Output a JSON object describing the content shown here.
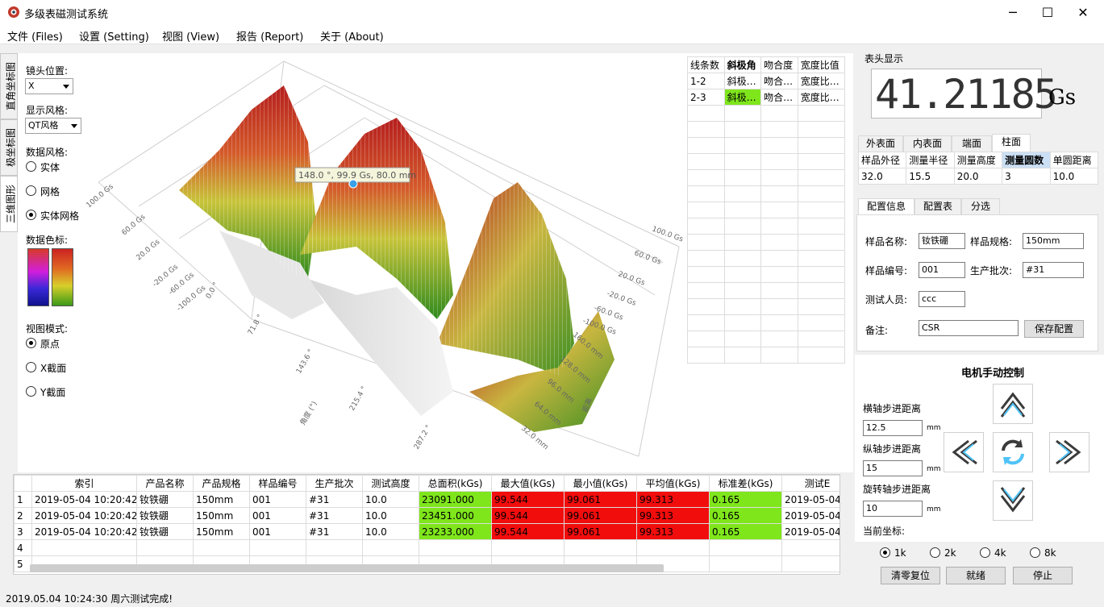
{
  "window": {
    "title": "多级表磁测试系统",
    "minimize": "─",
    "maximize": "☐",
    "close": "✕"
  },
  "menu": [
    "文件 (Files)",
    "设置 (Setting)",
    "视图 (View)",
    "报告 (Report)",
    "关于 (About)"
  ],
  "side_tabs": [
    "直角坐标图",
    "极坐标图",
    "三维图形"
  ],
  "controls": {
    "lens_label": "镜头位置:",
    "lens_value": "X",
    "display_style_label": "显示风格:",
    "display_style_value": "QT风格",
    "data_style_label": "数据风格:",
    "data_style_options": [
      "实体",
      "网格",
      "实体网格"
    ],
    "data_style_selected": 2,
    "color_scale_label": "数据色标:",
    "view_mode_label": "视图模式:",
    "view_mode_options": [
      "原点",
      "X截面",
      "Y截面"
    ],
    "view_mode_selected": 0
  },
  "plot": {
    "tooltip": "148.0 °, 99.9 Gs, 80.0 mm",
    "left_axis_labels": [
      "100.0 Gs",
      "60.0 Gs",
      "20.0 Gs",
      "-20.0 Gs",
      "-60.0 Gs",
      "-100.0 Gs"
    ],
    "right_axis_labels": [
      "100.0 Gs",
      "60.0 Gs",
      "20.0 Gs",
      "-20.0 Gs",
      "-60.0 Gs",
      "-100.0 Gs"
    ],
    "angle_labels": [
      "0.0 °",
      "71.8 °",
      "143.6 °",
      "215.4 °",
      "287.2 °"
    ],
    "angle_axis_title": "角度 (°)",
    "mm_labels": [
      "160.0 mm",
      "128.0 mm",
      "96.0 mm",
      "64.0 mm",
      "32.0 mm"
    ],
    "mm_axis_title": "距离"
  },
  "lines_table": {
    "headers": [
      "线条数",
      "斜极角",
      "吻合度",
      "宽度比值"
    ],
    "rows": [
      [
        "1-2",
        "斜极…",
        "吻合…",
        "宽度比…"
      ],
      [
        "2-3",
        "斜极…",
        "吻合…",
        "宽度比…"
      ]
    ]
  },
  "data_table": {
    "headers": [
      "",
      "索引",
      "产品名称",
      "产品规格",
      "样品编号",
      "生产批次",
      "测试高度",
      "总面积(kGs)",
      "最大值(kGs)",
      "最小值(kGs)",
      "平均值(kGs)",
      "标准差(kGs)",
      "测试E"
    ],
    "rows": [
      [
        "1",
        "2019-05-04 10:20:42",
        "钕铁硼",
        "150mm",
        "001",
        "#31",
        "10.0",
        "23091.000",
        "99.544",
        "99.061",
        "99.313",
        "0.165",
        "2019-05-04"
      ],
      [
        "2",
        "2019-05-04 10:20:42",
        "钕铁硼",
        "150mm",
        "001",
        "#31",
        "10.0",
        "23451.000",
        "99.544",
        "99.061",
        "99.313",
        "0.165",
        "2019-05-04"
      ],
      [
        "3",
        "2019-05-04 10:20:42",
        "钕铁硼",
        "150mm",
        "001",
        "#31",
        "10.0",
        "23233.000",
        "99.544",
        "99.061",
        "99.313",
        "0.165",
        "2019-05-04"
      ],
      [
        "4",
        "",
        "",
        "",
        "",
        "",
        "",
        "",
        "",
        "",
        "",
        "",
        ""
      ],
      [
        "5",
        "",
        "",
        "",
        "",
        "",
        "",
        "",
        "",
        "",
        "",
        "",
        ""
      ]
    ]
  },
  "meter": {
    "label": "表头显示",
    "value": "41.21185",
    "unit": "Gs"
  },
  "surface_tabs": [
    "外表面",
    "内表面",
    "端面",
    "柱面"
  ],
  "surface_tab_selected": 3,
  "surface_table": {
    "headers": [
      "样品外径",
      "测量半径",
      "测量高度",
      "测量圆数",
      "单圆距离"
    ],
    "values": [
      "32.0",
      "15.5",
      "20.0",
      "3",
      "10.0"
    ]
  },
  "config_tabs": [
    "配置信息",
    "配置表",
    "分选"
  ],
  "config": {
    "name_label": "样品名称:",
    "name_value": "钕铁硼",
    "spec_label": "样品规格:",
    "spec_value": "150mm",
    "serial_label": "样品编号:",
    "serial_value": "001",
    "batch_label": "生产批次:",
    "batch_value": "#31",
    "tester_label": "测试人员:",
    "tester_value": "ccc",
    "note_label": "备注:",
    "note_value": "CSR",
    "save_button": "保存配置"
  },
  "motor": {
    "title": "电机手动控制",
    "h_step_label": "横轴步进距离",
    "h_step_value": "12.5",
    "v_step_label": "纵轴步进距离",
    "v_step_value": "15",
    "r_step_label": "旋转轴步进距离",
    "r_step_value": "10",
    "unit": "mm",
    "coord_label": "当前坐标:",
    "speed_options": [
      "1k",
      "2k",
      "4k",
      "8k"
    ],
    "speed_selected": 0,
    "buttons": [
      "清零复位",
      "就绪",
      "停止"
    ]
  },
  "status": "2019.05.04 10:24:30 周六测试完成!"
}
